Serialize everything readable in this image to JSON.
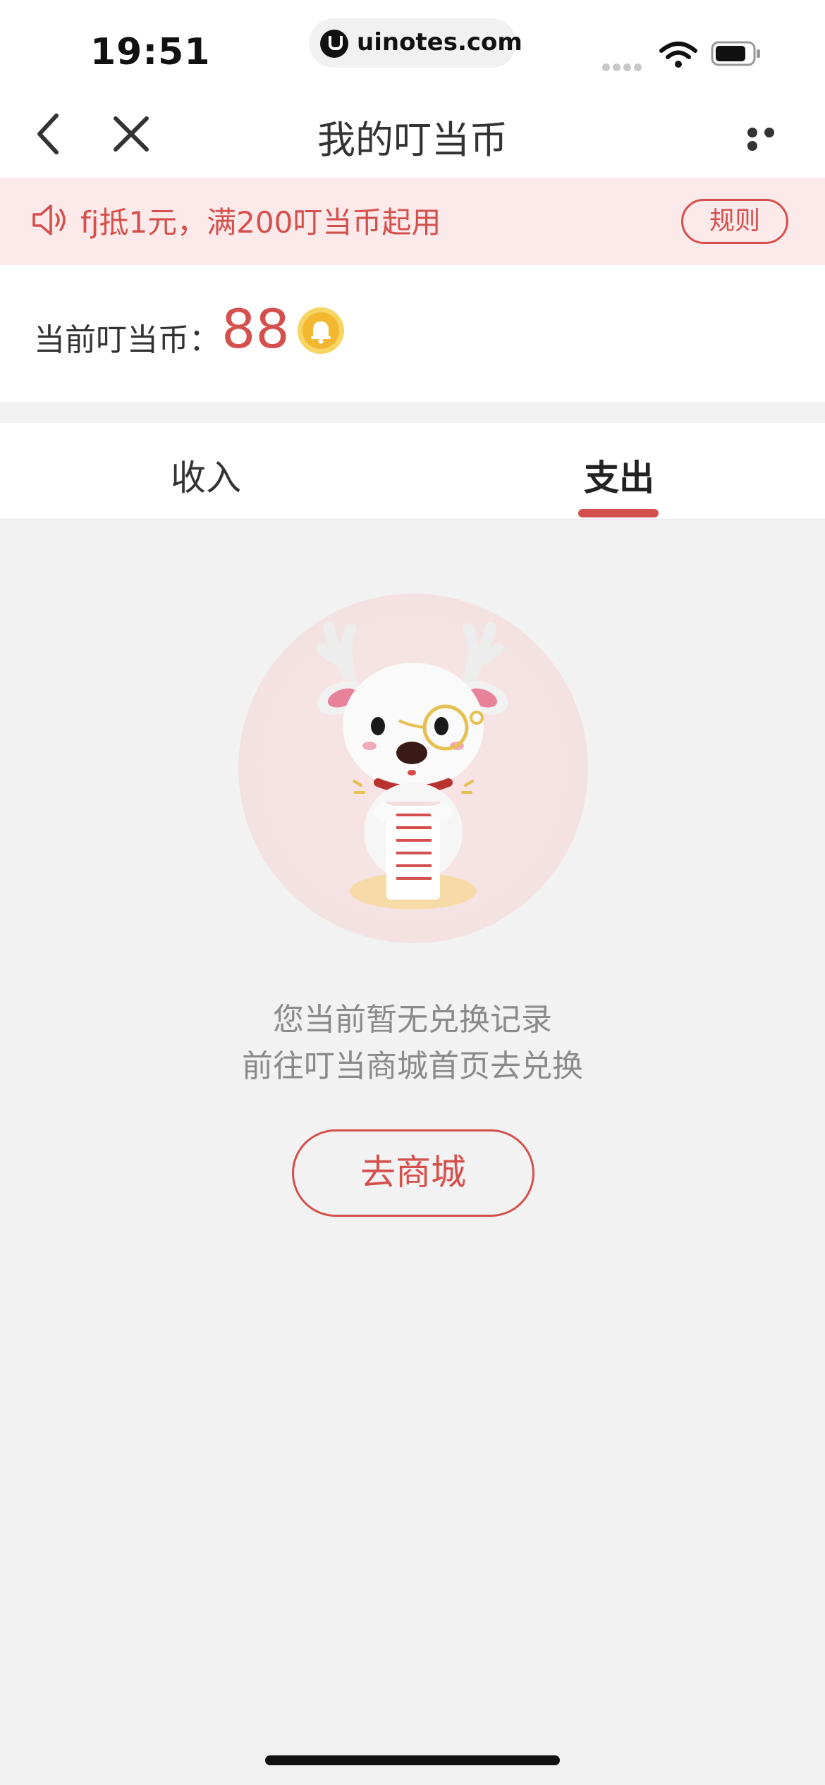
{
  "status_bar": {
    "time": "19:51",
    "url": "uinotes.com",
    "icons": [
      "signal-icon",
      "wifi-icon",
      "battery-icon"
    ]
  },
  "nav": {
    "title": "我的叮当币",
    "icons": [
      "back-icon",
      "close-icon",
      "more-icon"
    ]
  },
  "notice": {
    "text": "fj抵1元，满200叮当币起用",
    "rules_label": "规则",
    "icon": "speaker-icon"
  },
  "balance": {
    "label": "当前叮当币：",
    "value": "88",
    "icon": "coin-bell-icon"
  },
  "tabs": [
    {
      "label": "收入",
      "active": false
    },
    {
      "label": "支出",
      "active": true
    }
  ],
  "empty_state": {
    "line1": "您当前暂无兑换记录",
    "line2": "前往叮当商城首页去兑换",
    "button_label": "去商城",
    "illustration": "deer-mascot-with-receipt"
  },
  "colors": {
    "accent": "#d4504c",
    "notice_bg": "#fceaea",
    "page_bg": "#f2f2f2"
  }
}
